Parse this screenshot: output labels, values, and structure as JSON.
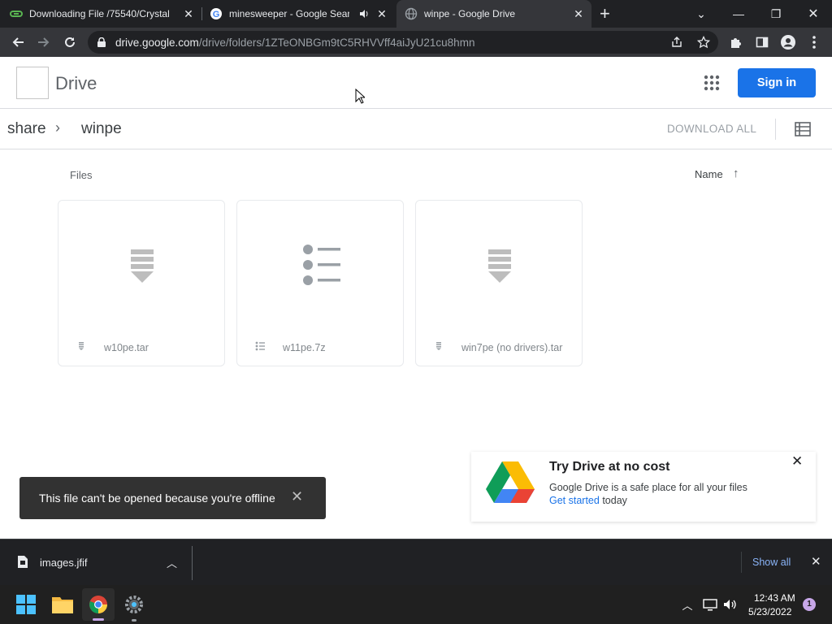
{
  "browser": {
    "tabs": [
      {
        "title": "Downloading File /75540/Crystal",
        "icon": "download-site-icon"
      },
      {
        "title": "minesweeper - Google Searc",
        "icon": "google-icon",
        "audio": "speaker-icon"
      },
      {
        "title": "winpe - Google Drive",
        "icon": "globe-icon",
        "active": true
      }
    ],
    "new_tab": "+",
    "url_host": "drive.google.com",
    "url_path": "/drive/folders/1ZTeONBGm9tC5RHVVff4aiJyU21cu8hmn"
  },
  "drive": {
    "title": "Drive",
    "sign_in": "Sign in",
    "breadcrumb": [
      "share",
      "winpe"
    ],
    "download_all": "DOWNLOAD ALL",
    "files_label": "Files",
    "sort_label": "Name",
    "files": [
      {
        "name": "w10pe.tar",
        "icon": "archive-icon"
      },
      {
        "name": "w11pe.7z",
        "icon": "list-file-icon"
      },
      {
        "name": "win7pe (no drivers).tar",
        "icon": "archive-icon"
      }
    ]
  },
  "toast": {
    "message": "This file can't be opened because you're offline"
  },
  "promo": {
    "title": "Try Drive at no cost",
    "description": "Google Drive is a safe place for all your files",
    "cta_link": "Get started",
    "cta_suffix": " today"
  },
  "download_shelf": {
    "file": "images.jfif",
    "show_all": "Show all"
  },
  "taskbar": {
    "time": "12:43 AM",
    "date": "5/23/2022",
    "notifications": "1"
  },
  "colors": {
    "accent": "#1a73e8",
    "chrome_dark": "#202124",
    "toast_bg": "#323232"
  }
}
